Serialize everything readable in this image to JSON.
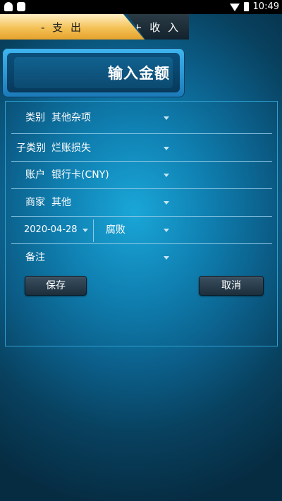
{
  "status_bar": {
    "time": "10:49",
    "icons": [
      "notification-ghost-icon",
      "sd-card-icon",
      "wifi-icon",
      "battery-icon"
    ]
  },
  "tabs": {
    "expense_label": "- 支 出",
    "income_label": "+ 收 入",
    "active": "expense"
  },
  "amount": {
    "placeholder": "输入金额"
  },
  "form": {
    "category": {
      "label": "类别",
      "value": "其他杂项"
    },
    "subcategory": {
      "label": "子类别",
      "value": "烂账损失"
    },
    "account": {
      "label": "账户",
      "value": "银行卡(CNY)"
    },
    "merchant": {
      "label": "商家",
      "value": "其他"
    },
    "date": {
      "value": "2020-04-28"
    },
    "tag": {
      "value": "腐败"
    },
    "note": {
      "label": "备注",
      "value": ""
    }
  },
  "buttons": {
    "save": "保存",
    "cancel": "取消"
  },
  "colors": {
    "active_tab": "#f4c156",
    "accent_border": "#2f9fd0",
    "background_center": "#1aa6d8",
    "background_edge": "#062c42"
  }
}
